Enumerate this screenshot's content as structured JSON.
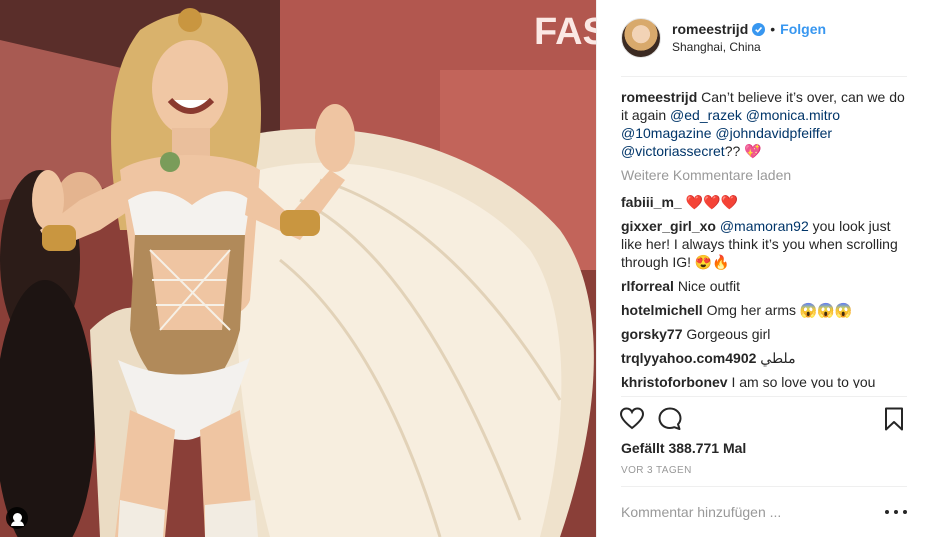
{
  "post": {
    "username": "romeestrijd",
    "follow_label": "Folgen",
    "separator": "•",
    "location": "Shanghai, China",
    "photo_sign_text": "FAS"
  },
  "caption": {
    "user": "romeestrijd",
    "text": "Can’t believe it’s over, can we do it again",
    "mentions": [
      "@ed_razek",
      "@monica.mitro",
      "@10magazine",
      "@johndavidpfeiffer",
      "@victoriassecret"
    ],
    "suffix": "?? 💖"
  },
  "load_more_label": "Weitere Kommentare laden",
  "comments": [
    {
      "user": "fabiii_m_",
      "mention": "",
      "text": "❤️❤️❤️"
    },
    {
      "user": "gixxer_girl_xo",
      "mention": "@mamoran92",
      "text": "you look just like her! I always think it’s you when scrolling through IG! 😍🔥"
    },
    {
      "user": "rlforreal",
      "mention": "",
      "text": "Nice outfit"
    },
    {
      "user": "hotelmichell",
      "mention": "",
      "text": "Omg her arms 😱😱😱"
    },
    {
      "user": "gorsky77",
      "mention": "",
      "text": "Gorgeous girl"
    },
    {
      "user": "trqlyyahoo.com4902",
      "mention": "",
      "text": "ملطي"
    },
    {
      "user": "khristoforbonev",
      "mention": "",
      "text": "I am so love you to you"
    }
  ],
  "likes_text": "Gefällt 388.771 Mal",
  "time_ago": "VOR 3 TAGEN",
  "comment_input": {
    "placeholder": "Kommentar hinzufügen ..."
  },
  "icons": {
    "like": "heart-icon",
    "comment": "comment-bubble-icon",
    "save": "bookmark-icon",
    "more": "more-dots-icon",
    "verified": "verified-badge-icon",
    "tagged": "tagged-user-icon"
  },
  "colors": {
    "link": "#3897f0",
    "mention": "#003569",
    "muted": "#999999",
    "text": "#262626",
    "divider": "#efefef"
  }
}
